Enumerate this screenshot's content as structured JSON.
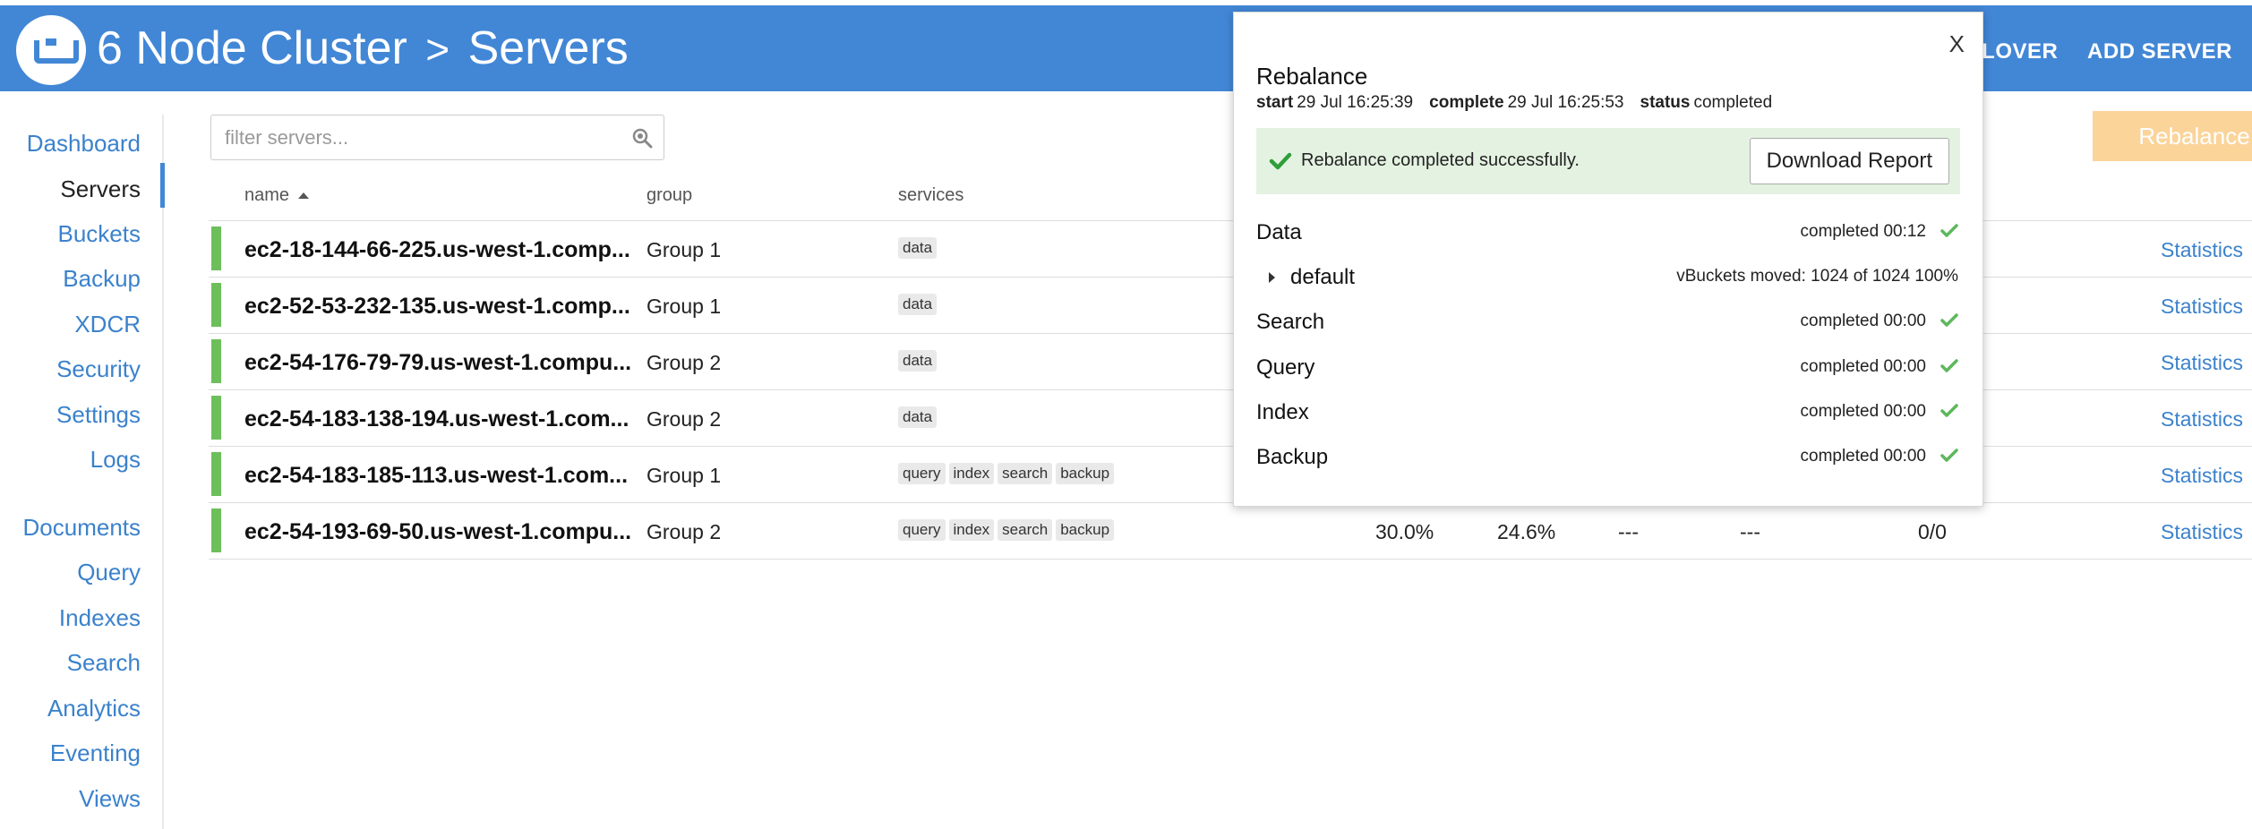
{
  "header": {
    "title": "6 Node Cluster",
    "separator": ">",
    "section": "Servers",
    "failover_label": "ILOVER",
    "add_server_label": "ADD SERVER"
  },
  "sidebar": {
    "items": [
      {
        "label": "Dashboard"
      },
      {
        "label": "Servers",
        "active": true
      },
      {
        "label": "Buckets"
      },
      {
        "label": "Backup"
      },
      {
        "label": "XDCR"
      },
      {
        "label": "Security"
      },
      {
        "label": "Settings"
      },
      {
        "label": "Logs"
      },
      {
        "label": "Documents"
      },
      {
        "label": "Query"
      },
      {
        "label": "Indexes"
      },
      {
        "label": "Search"
      },
      {
        "label": "Analytics"
      },
      {
        "label": "Eventing"
      },
      {
        "label": "Views"
      }
    ]
  },
  "filter": {
    "placeholder": "filter servers..."
  },
  "rebalance_button": "Rebalance",
  "table": {
    "columns": {
      "name": "name",
      "group": "group",
      "services": "services"
    },
    "rows": [
      {
        "name": "ec2-18-144-66-225.us-west-1.comp...",
        "group": "Group 1",
        "services": [
          "data"
        ],
        "stats": "Statistics"
      },
      {
        "name": "ec2-52-53-232-135.us-west-1.comp...",
        "group": "Group 1",
        "services": [
          "data"
        ],
        "stats": "Statistics"
      },
      {
        "name": "ec2-54-176-79-79.us-west-1.compu...",
        "group": "Group 2",
        "services": [
          "data"
        ],
        "stats": "Statistics"
      },
      {
        "name": "ec2-54-183-138-194.us-west-1.com...",
        "group": "Group 2",
        "services": [
          "data"
        ],
        "stats": "Statistics"
      },
      {
        "name": "ec2-54-183-185-113.us-west-1.com...",
        "group": "Group 1",
        "services": [
          "query",
          "index",
          "search",
          "backup"
        ],
        "stats": "Statistics"
      },
      {
        "name": "ec2-54-193-69-50.us-west-1.compu...",
        "group": "Group 2",
        "services": [
          "query",
          "index",
          "search",
          "backup"
        ],
        "cpu": "30.0%",
        "ram": "24.6%",
        "swap": "---",
        "disk": "---",
        "items": "0/0",
        "stats": "Statistics"
      }
    ]
  },
  "popup": {
    "close": "X",
    "title": "Rebalance",
    "start_label": "start",
    "start_value": "29 Jul 16:25:39",
    "complete_label": "complete",
    "complete_value": "29 Jul 16:25:53",
    "status_label": "status",
    "status_value": "completed",
    "success_message": "Rebalance completed successfully.",
    "download_button": "Download Report",
    "services": [
      {
        "name": "Data",
        "status": "completed 00:12"
      },
      {
        "name": "default",
        "bucket": true,
        "status": "vBuckets moved: 1024 of 1024   100%"
      },
      {
        "name": "Search",
        "status": "completed 00:00"
      },
      {
        "name": "Query",
        "status": "completed 00:00"
      },
      {
        "name": "Index",
        "status": "completed 00:00"
      },
      {
        "name": "Backup",
        "status": "completed 00:00"
      }
    ],
    "check_color": "#5cb85c"
  },
  "colors": {
    "header_bg": "#4287d6",
    "link": "#3b82cc",
    "healthy": "#6dbf5b",
    "rebalance_disabled": "#fbd49a"
  }
}
